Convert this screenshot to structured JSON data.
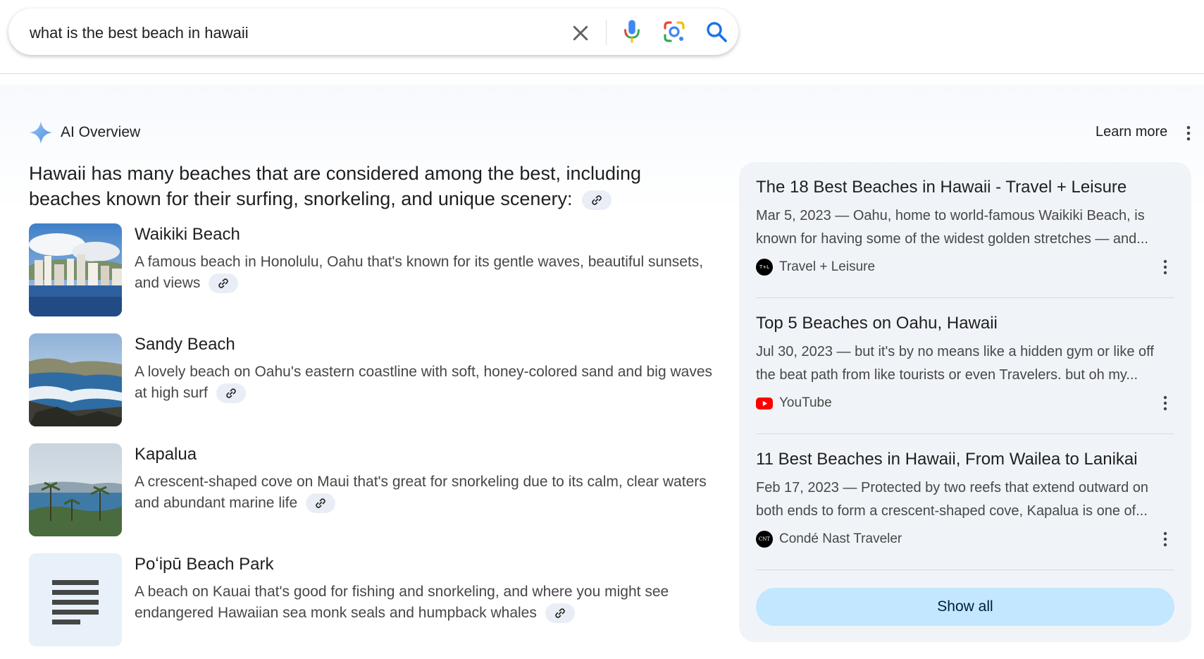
{
  "search": {
    "query": "what is the best beach in hawaii",
    "clear_icon": "close-icon",
    "mic_icon": "microphone-icon",
    "lens_icon": "google-lens-icon",
    "search_icon": "search-icon"
  },
  "ai_overview": {
    "title": "AI Overview",
    "learn_more": "Learn more",
    "intro": "Hawaii has many beaches that are considered among the best, including beaches known for their surfing, snorkeling, and unique scenery:",
    "beaches": [
      {
        "name": "Waikiki Beach",
        "description": "A famous beach in Honolulu, Oahu that's known for its gentle waves, beautiful sunsets, and views"
      },
      {
        "name": "Sandy Beach",
        "description": "A lovely beach on Oahu's eastern coastline with soft, honey-colored sand and big waves at high surf"
      },
      {
        "name": "Kapalua",
        "description": "A crescent-shaped cove on Maui that's great for snorkeling due to its calm, clear waters and abundant marine life"
      },
      {
        "name": "Poʻipū Beach Park",
        "description": "A beach on Kauai that's good for fishing and snorkeling, and where you might see endangered Hawaiian sea monk seals and humpback whales"
      }
    ]
  },
  "sources": {
    "items": [
      {
        "title": "The 18 Best Beaches in Hawaii - Travel + Leisure",
        "snippet": "Mar 5, 2023 — Oahu, home to world-famous Waikiki Beach, is known for having some of the widest golden stretches — and...",
        "site": "Travel + Leisure",
        "favicon_text": "T+L"
      },
      {
        "title": "Top 5 Beaches on Oahu, Hawaii",
        "snippet": "Jul 30, 2023 — but it's by no means like a hidden gym or like off the beat path from like tourists or even Travelers. but oh my...",
        "site": "YouTube",
        "favicon_text": ""
      },
      {
        "title": "11 Best Beaches in Hawaii, From Wailea to Lanikai",
        "snippet": "Feb 17, 2023 — Protected by two reefs that extend outward on both ends to form a crescent-shaped cove, Kapalua is one of...",
        "site": "Condé Nast Traveler",
        "favicon_text": "CNT"
      }
    ],
    "show_all": "Show all"
  },
  "colors": {
    "accent_blue": "#1a73e8",
    "show_all_bg": "#c2e7ff",
    "card_bg": "#f0f4f9",
    "youtube_red": "#ff0000"
  }
}
